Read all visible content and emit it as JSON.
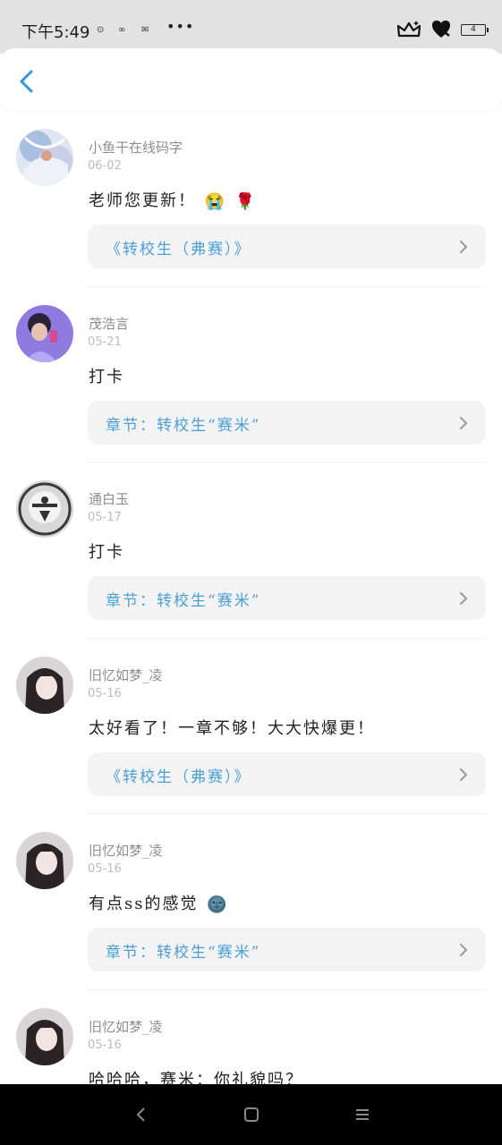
{
  "status_bar": {
    "time": "下午5:49",
    "indicators": [
      "⊙",
      "∞",
      "✉"
    ],
    "dots": "•••",
    "battery": "4",
    "icons": [
      "crown-icon",
      "heart-shield-icon",
      "battery-icon"
    ]
  },
  "header": {
    "back_icon": "chevron-left-icon",
    "accent_color": "#2f95dc"
  },
  "comments": [
    {
      "username": "小鱼干在线码字",
      "date": "06-02",
      "content": "老师您更新！",
      "emojis": [
        "😭",
        "🌹"
      ],
      "chapter": "《转校生（弗赛）》"
    },
    {
      "username": "茂浩言",
      "date": "05-21",
      "content": "打卡",
      "emojis": [],
      "chapter": "章节：转校生“赛米”"
    },
    {
      "username": "通白玉",
      "date": "05-17",
      "content": "打卡",
      "emojis": [],
      "chapter": "章节：转校生“赛米”"
    },
    {
      "username": "旧忆如梦_凌",
      "date": "05-16",
      "content": "太好看了！一章不够！大大快爆更！",
      "emojis": [],
      "chapter": "《转校生（弗赛）》"
    },
    {
      "username": "旧忆如梦_凌",
      "date": "05-16",
      "content": "有点ss的感觉",
      "emojis": [
        "🌚"
      ],
      "chapter": "章节：转校生“赛米”"
    },
    {
      "username": "旧忆如梦_凌",
      "date": "05-16",
      "content": "哈哈哈，赛米：你礼貌吗？",
      "emojis": [],
      "chapter": ""
    }
  ],
  "nav_bar": {
    "icons": [
      "back-nav-icon",
      "home-nav-icon",
      "menu-nav-icon"
    ]
  },
  "colors": {
    "chapter_text": "#4a9fd6",
    "username": "#8d8d8d",
    "date": "#bcbcbc",
    "chapter_bg": "#f3f3f3"
  }
}
